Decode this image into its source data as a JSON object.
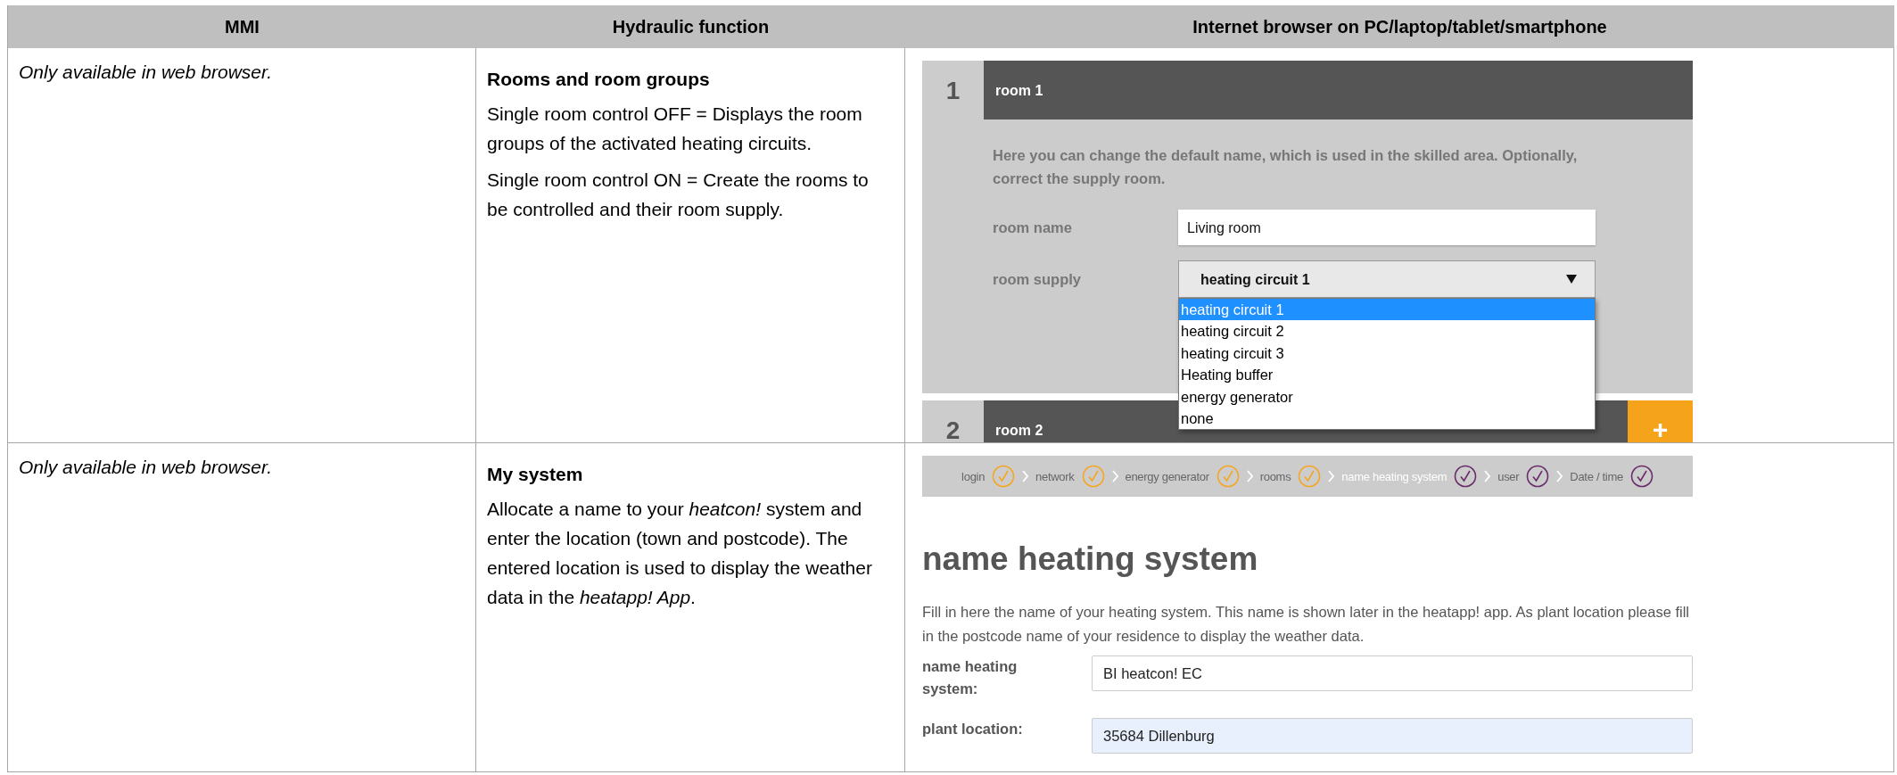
{
  "table": {
    "columns": [
      "MMI",
      "Hydraulic function",
      "Internet browser on PC/laptop/tablet/smartphone"
    ],
    "rows": [
      {
        "mmi": "Only available in web browser.",
        "function": {
          "title": "Rooms and room groups",
          "paragraphs": [
            "Single room control OFF = Displays the room groups of the activated heating circuits.",
            "Single room control ON = Create the rooms to be controlled and their room supply."
          ]
        },
        "browser": {
          "kind": "rooms",
          "rooms": [
            {
              "number": "1",
              "name": "room 1",
              "expanded": true
            },
            {
              "number": "2",
              "name": "room 2",
              "expanded": false
            }
          ],
          "intro": "Here you can change the default name, which is used in the skilled area. Optionally, correct the supply room.",
          "room_name": {
            "label": "room name",
            "value": "Living room"
          },
          "room_supply": {
            "label": "room supply",
            "value": "heating circuit 1",
            "expanded": true,
            "options": [
              {
                "label": "heating circuit 1",
                "selected": true
              },
              {
                "label": "heating circuit 2",
                "selected": false
              },
              {
                "label": "heating circuit 3",
                "selected": false
              },
              {
                "label": "Heating buffer",
                "selected": false
              },
              {
                "label": "energy generator",
                "selected": false
              },
              {
                "label": "none",
                "selected": false
              }
            ]
          },
          "add_button": "+"
        }
      },
      {
        "mmi": "Only available in web browser.",
        "function": {
          "title": "My system",
          "paragraphs": [
            "Allocate a name to your *heatcon!* system and enter the location (town and postcode). The entered location is used to display the weather data in the *heatapp! App*."
          ]
        },
        "browser": {
          "kind": "wizard",
          "steps": [
            {
              "label": "login",
              "done": true,
              "selected": false
            },
            {
              "label": "network",
              "done": true,
              "selected": false
            },
            {
              "label": "energy generator",
              "done": true,
              "selected": false
            },
            {
              "label": "rooms",
              "done": true,
              "selected": false
            },
            {
              "label": "name heating system",
              "done": false,
              "selected": true
            },
            {
              "label": "user",
              "done": false,
              "selected": false
            },
            {
              "label": "Date / time",
              "done": false,
              "selected": false
            }
          ],
          "heading": "name heating system",
          "description": "Fill in here the name of your heating system. This name is shown later in the heatapp! app. As plant location please fill in the postcode name of your residence to display the weather data.",
          "fields": [
            {
              "label": "name heating system:",
              "value": "BI heatcon! EC",
              "autofilled": false
            },
            {
              "label": "plant location:",
              "value": "35684 Dillenburg",
              "autofilled": true
            }
          ]
        }
      }
    ]
  }
}
